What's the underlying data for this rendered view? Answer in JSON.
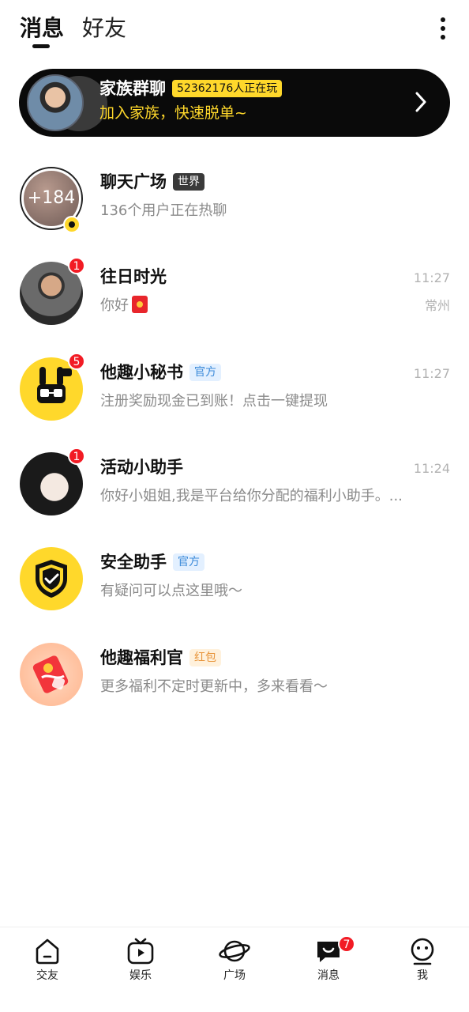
{
  "header": {
    "tabs": [
      {
        "label": "消息"
      },
      {
        "label": "好友"
      }
    ]
  },
  "family": {
    "title": "家族群聊",
    "online": "52362176人正在玩",
    "subtitle": "加入家族，快速脱单~"
  },
  "messages": [
    {
      "name": "聊天广场",
      "tag": "世界",
      "sub": "136个用户正在热聊",
      "avatar_text": "+184"
    },
    {
      "name": "往日时光",
      "sub": "你好",
      "time": "11:27",
      "location": "常州",
      "badge": "1"
    },
    {
      "name": "他趣小秘书",
      "tag": "官方",
      "sub": "注册奖励现金已到账！点击一键提现",
      "time": "11:27",
      "badge": "5"
    },
    {
      "name": "活动小助手",
      "sub": "你好小姐姐,我是平台给你分配的福利小助手。...",
      "time": "11:24",
      "badge": "1"
    },
    {
      "name": "安全助手",
      "tag": "官方",
      "sub": "有疑问可以点这里哦～"
    },
    {
      "name": "他趣福利官",
      "tag": "红包",
      "sub": "更多福利不定时更新中，多来看看～"
    }
  ],
  "nav": [
    {
      "label": "交友",
      "icon": "friends-icon"
    },
    {
      "label": "娱乐",
      "icon": "tv-icon"
    },
    {
      "label": "广场",
      "icon": "planet-icon"
    },
    {
      "label": "消息",
      "icon": "message-icon",
      "badge": "7"
    },
    {
      "label": "我",
      "icon": "profile-icon"
    }
  ],
  "colors": {
    "accent": "#ffd82b",
    "badge": "#f21b24",
    "official_tag": "#3b8ad9"
  }
}
